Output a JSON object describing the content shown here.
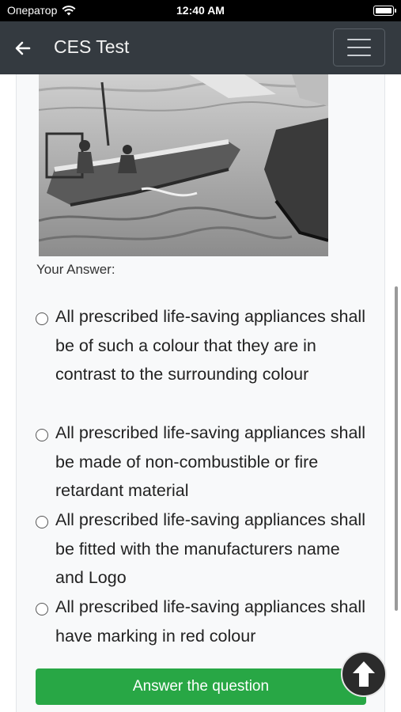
{
  "status_bar": {
    "carrier": "Оператор",
    "time": "12:40 AM",
    "wifi_icon": "wifi-icon",
    "battery_icon": "battery-icon"
  },
  "navbar": {
    "title": "CES Test",
    "back_icon": "arrow-left-icon",
    "menu_icon": "hamburger-menu-icon"
  },
  "question": {
    "image_icon": "boat-illustration",
    "answer_label": "Your Answer:",
    "options": [
      {
        "label": "All prescribed life-saving appliances shall be of such a colour that they are in contrast to the surrounding colour",
        "selected": false
      },
      {
        "label": "All prescribed life-saving appliances shall be made of non-combustible or fire retardant material",
        "selected": false
      },
      {
        "label": "All prescribed life-saving appliances shall be fitted with the manufacturers name and Logo",
        "selected": false
      },
      {
        "label": "All prescribed life-saving appliances shall have marking in red colour",
        "selected": false
      }
    ],
    "submit_label": "Answer the question"
  },
  "scroll_top_icon": "arrow-up-circle-icon",
  "colors": {
    "navbar": "#343a40",
    "button": "#28a745",
    "content_bg": "#f8f9fa"
  }
}
